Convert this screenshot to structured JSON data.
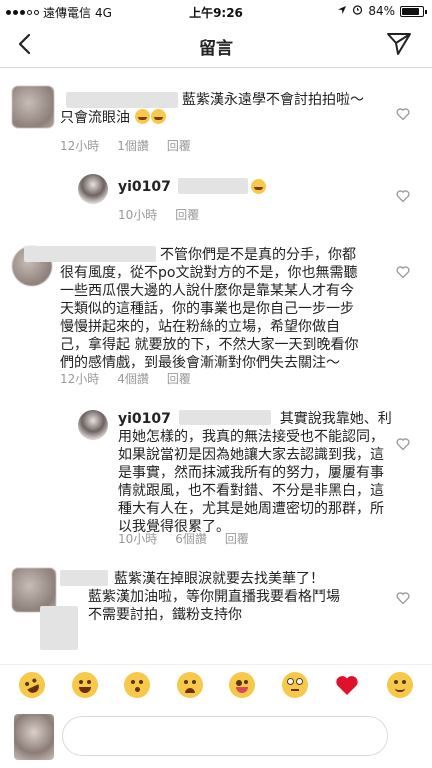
{
  "status_bar": {
    "carrier": "遠傳電信",
    "network": "4G",
    "time": "上午9:26",
    "battery": "84%",
    "battery_level": 0.84
  },
  "header": {
    "title": "留言"
  },
  "comments": [
    {
      "text_line1": "藍紫漢永遠學不會討拍拍啦～",
      "text_line2": "只會流眼油",
      "time": "12小時",
      "likes": "1個讚",
      "reply": "回覆"
    },
    {
      "username": "yi0107",
      "time": "10小時",
      "reply": "回覆"
    },
    {
      "lines": [
        "不管你們是不是真的分手，你都",
        "很有風度，從不po文說對方的不是，你也無需聽",
        "一些西瓜偎大邊的人說什麼你是靠某某人才有今",
        "天類似的這種話，你的事業也是你自己一步一步",
        "慢慢拼起來的，站在粉絲的立場，希望你做自",
        "己，拿得起 就要放的下，不然大家一天到晚看你",
        "們的感情戲，到最後會漸漸對你們失去關注～"
      ],
      "time": "12小時",
      "likes": "4個讚",
      "reply": "回覆"
    },
    {
      "username": "yi0107",
      "lines": [
        "其實說我靠她、利",
        "用她怎樣的，我真的無法接受也不能認同，",
        "如果說當初是因為她讓大家去認識到我，這",
        "是事實，然而抹滅我所有的努力，屢屢有事",
        "情就跟風，也不看對錯、不分是非黑白，這",
        "種大有人在，尤其是她周遭密切的那群，所",
        "以我覺得很累了。"
      ],
      "time": "10小時",
      "likes": "6個讚",
      "reply": "回覆"
    },
    {
      "lines": [
        "藍紫漢在掉眼淚就要去找美華了！",
        "藍紫漢加油啦，等你開直播我要看格鬥場",
        "不需要討拍，鐵粉支持你"
      ]
    }
  ],
  "emoji_bar": [
    "rofl-emoji",
    "laughing-tears-emoji",
    "kiss-emoji",
    "crying-emoji",
    "zany-emoji",
    "eye-roll-emoji",
    "red-heart-emoji",
    "smile-emoji"
  ],
  "input": {
    "placeholder": ""
  },
  "colors": {
    "meta_gray": "#999999",
    "heart_red": "#e0112b",
    "emoji_yellow": "#f7c94b"
  }
}
